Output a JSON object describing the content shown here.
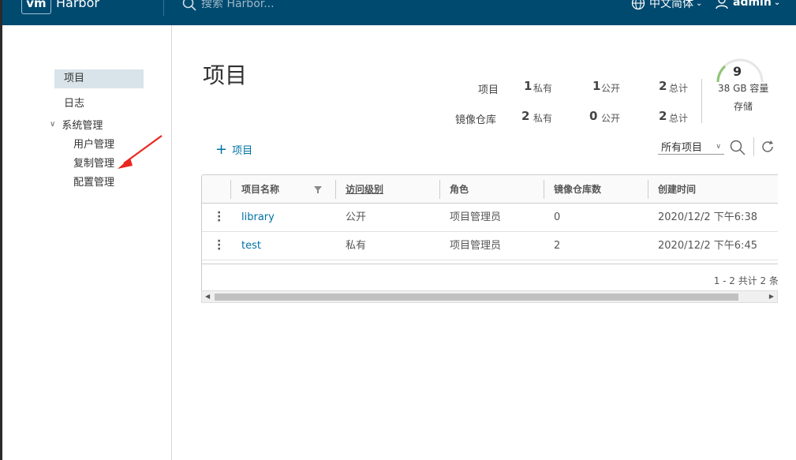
{
  "header": {
    "logo": "vm",
    "title": "Harbor",
    "search_placeholder": "搜索 Harbor...",
    "language": "中文简体",
    "user": "admin"
  },
  "sidebar": {
    "items": [
      {
        "label": "项目"
      },
      {
        "label": "日志"
      }
    ],
    "group": {
      "label": "系统管理",
      "children": [
        {
          "label": "用户管理"
        },
        {
          "label": "复制管理"
        },
        {
          "label": "配置管理"
        }
      ]
    }
  },
  "main": {
    "title": "项目",
    "stats": {
      "projects": {
        "label": "项目",
        "private": "1",
        "private_label": "私有",
        "public": "1",
        "public_label": "公开",
        "total": "2",
        "total_label": "总计"
      },
      "repos": {
        "label": "镜像仓库",
        "private": "2",
        "private_label": "私有",
        "public": "0",
        "public_label": "公开",
        "total": "2",
        "total_label": "总计"
      }
    },
    "quota": {
      "count": "9",
      "capacity": "38 GB 容量",
      "storage": "存储"
    },
    "add_button": "项目",
    "filter": "所有项目",
    "table": {
      "columns": [
        "项目名称",
        "访问级别",
        "角色",
        "镜像仓库数",
        "创建时间"
      ],
      "rows": [
        {
          "name": "library",
          "access": "公开",
          "role": "项目管理员",
          "repos": "0",
          "created": "2020/12/2 下午6:38"
        },
        {
          "name": "test",
          "access": "私有",
          "role": "项目管理员",
          "repos": "2",
          "created": "2020/12/2 下午6:45"
        }
      ],
      "pagination": "1 - 2 共计 2 条"
    }
  },
  "colors": {
    "header_bg": "#004a70",
    "link": "#0072a3",
    "nav_active_bg": "#d9e4ea",
    "annotation_arrow": "#e8281e",
    "gauge_fill": "#8dc572"
  }
}
